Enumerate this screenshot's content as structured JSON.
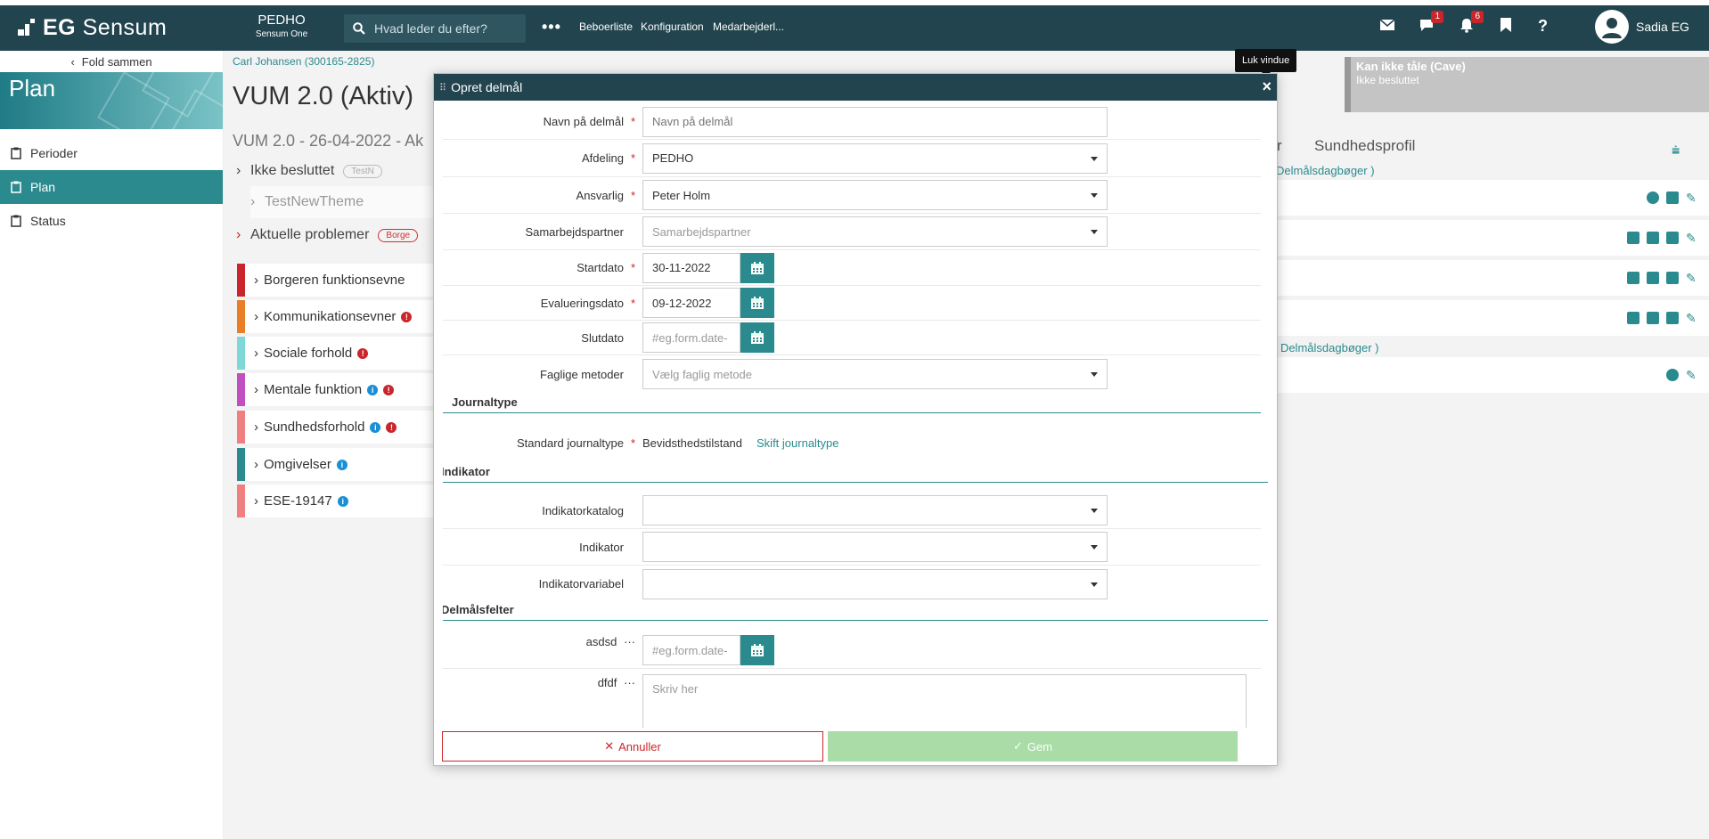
{
  "topbar": {
    "logo": {
      "prefix": "EG",
      "name": "Sensum"
    },
    "org": {
      "name": "PEDHO",
      "sub": "Sensum One"
    },
    "search_placeholder": "Hvad leder du efter?",
    "nav": [
      "Beboerliste",
      "Konfiguration",
      "Medarbejderl..."
    ],
    "messages_badge": "1",
    "notifications_badge": "6",
    "help": "?",
    "user": "Sadia EG"
  },
  "sidebar": {
    "fold": "Fold sammen",
    "banner": "Plan",
    "items": [
      {
        "label": "Perioder",
        "active": false
      },
      {
        "label": "Plan",
        "active": true
      },
      {
        "label": "Status",
        "active": false
      }
    ]
  },
  "main": {
    "breadcrumb": "Carl Johansen (300165-2825)",
    "title": "VUM 2.0 (Aktiv)",
    "subtitle": "VUM 2.0 - 26-04-2022 - Ak",
    "tree": [
      {
        "label": "Ikke besluttet",
        "tag": "TestN"
      },
      {
        "label": "TestNewTheme"
      },
      {
        "label": "Aktuelle problemer",
        "tag": "Borge"
      }
    ],
    "problems": [
      {
        "label": "Borgeren funktionsevne",
        "color": "#c9262b",
        "icons": []
      },
      {
        "label": "Kommunikationsevner",
        "color": "#e87e26",
        "icons": [
          "red"
        ]
      },
      {
        "label": "Sociale forhold",
        "color": "#7fd8d8",
        "icons": [
          "red"
        ]
      },
      {
        "label": "Mentale funktion",
        "color": "#c24fbf",
        "icons": [
          "blue",
          "red"
        ]
      },
      {
        "label": "Sundhedsforhold",
        "color": "#f08080",
        "icons": [
          "blue",
          "red"
        ]
      },
      {
        "label": "Omgivelser",
        "color": "#2a8a8e",
        "icons": [
          "blue"
        ]
      },
      {
        "label": "ESE-19147",
        "color": "#f08080",
        "icons": [
          "blue"
        ]
      }
    ],
    "cave": {
      "title": "Kan ikke tåle (Cave)",
      "status": "Ikke besluttet"
    },
    "tab_r": "r",
    "tab_sundhedsprofil": "Sundhedsprofil",
    "link1": "Delmålsdagbøger )",
    "link2": ") Delmålsdagbøger )"
  },
  "tooltip": "Luk vindue",
  "modal": {
    "title": "Opret delmål",
    "fields": {
      "navn": {
        "label": "Navn på delmål",
        "placeholder": "Navn på delmål"
      },
      "afdeling": {
        "label": "Afdeling",
        "value": "PEDHO"
      },
      "ansvarlig": {
        "label": "Ansvarlig",
        "value": "Peter Holm"
      },
      "samarbejd": {
        "label": "Samarbejdspartner",
        "placeholder": "Samarbejdspartner"
      },
      "startdato": {
        "label": "Startdato",
        "value": "30-11-2022"
      },
      "evaldato": {
        "label": "Evalueringsdato",
        "value": "09-12-2022"
      },
      "slutdato": {
        "label": "Slutdato",
        "placeholder": "#eg.form.date-"
      },
      "metoder": {
        "label": "Faglige metoder",
        "placeholder": "Vælg faglig metode"
      }
    },
    "journal_section": "Journaltype",
    "journal_label": "Standard journaltype",
    "journal_value": "Bevidsthedstilstand",
    "journal_link": "Skift journaltype",
    "indikator_section": "Indikator",
    "indikatorkatalog": "Indikatorkatalog",
    "indikator": "Indikator",
    "indikatorvariabel": "Indikatorvariabel",
    "delmaal_section": "Delmålsfelter",
    "asdsd": {
      "label": "asdsd",
      "placeholder": "#eg.form.date-"
    },
    "dfdf": {
      "label": "dfdf",
      "placeholder": "Skriv her"
    },
    "ellipsis": "···",
    "cancel": "Annuller",
    "save": "Gem"
  }
}
